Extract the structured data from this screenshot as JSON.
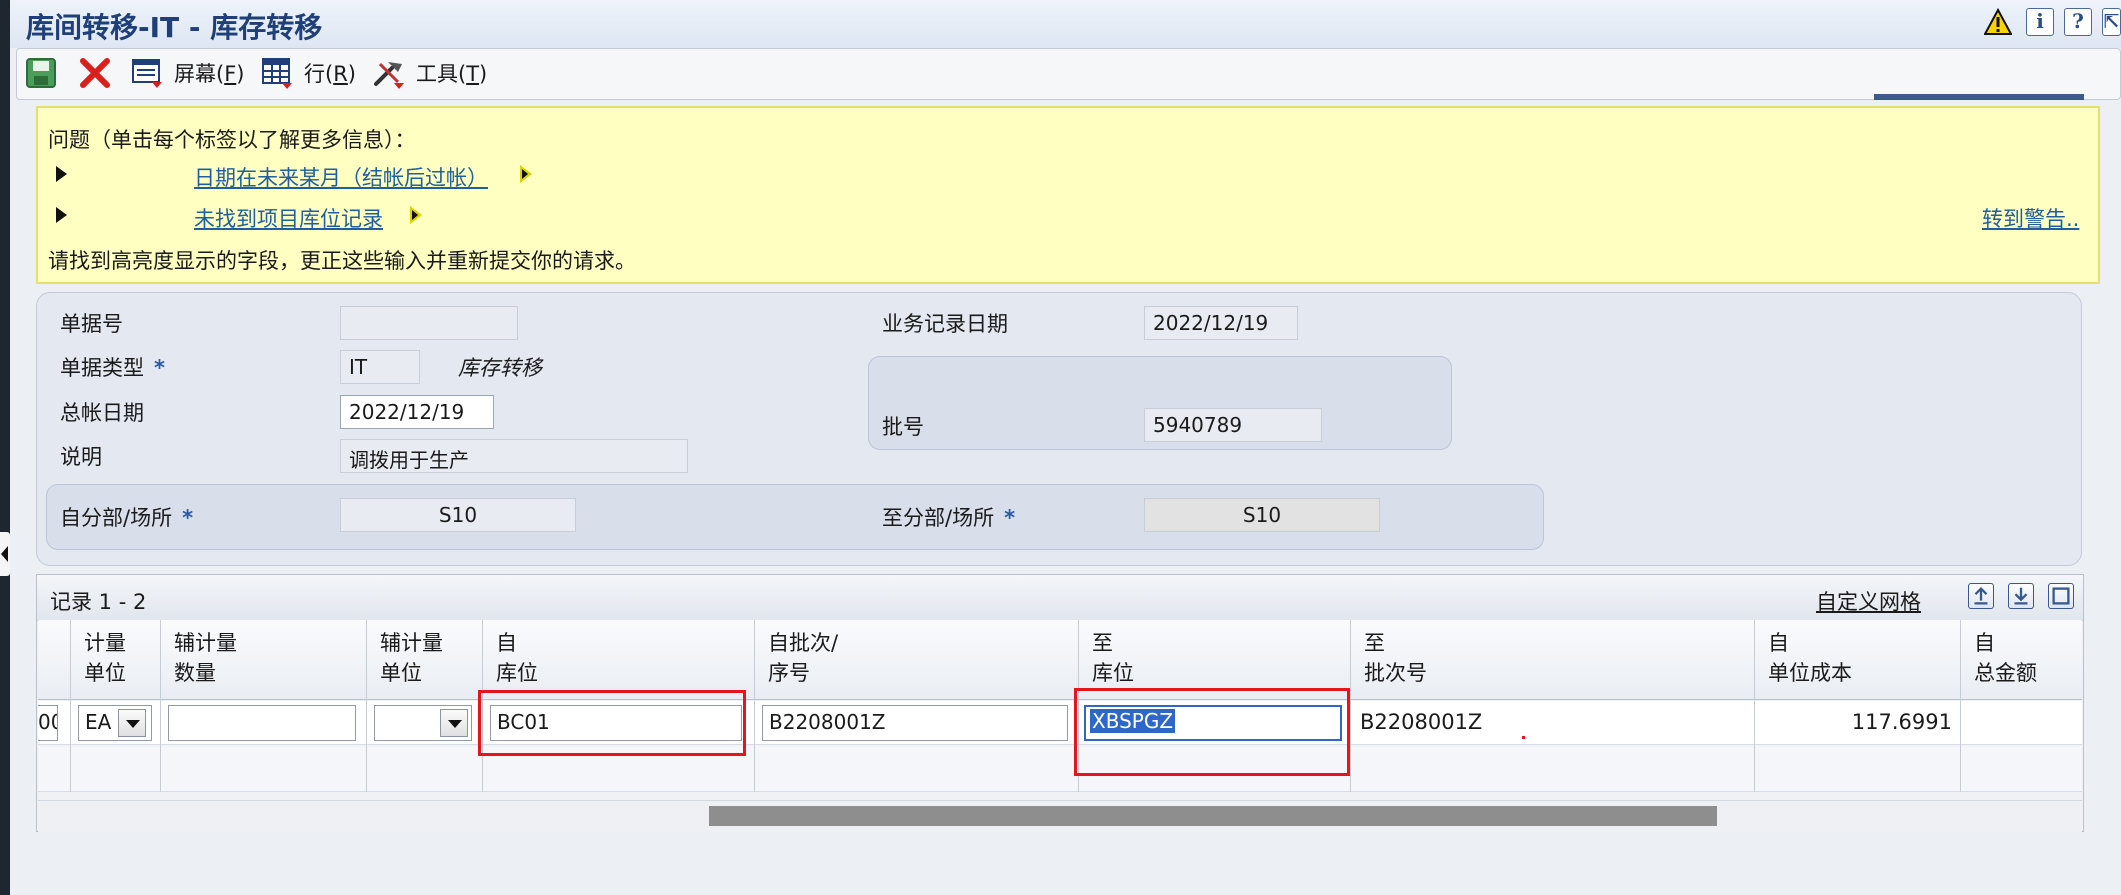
{
  "window": {
    "title": "库间转移-IT - 库存转移"
  },
  "toolbar": {
    "save_icon": "save-icon",
    "cancel_icon": "close-icon",
    "screen_label": "屏幕(",
    "screen_key": "F",
    "row_label": "行(",
    "row_key": "R",
    "tools_label": "工具(",
    "tools_key": "T",
    "close_paren": ")"
  },
  "messages": {
    "header": "问题（单击每个标签以了解更多信息）：",
    "items": [
      {
        "link": "日期在未来某月（结帐后过帐）"
      },
      {
        "link": "未找到项目库位记录"
      }
    ],
    "footer": "请找到高亮度显示的字段，更正这些输入并重新提交你的请求。",
    "goto_warning": "转到警告.."
  },
  "form": {
    "doc_no_label": "单据号",
    "doc_no_value": "",
    "doc_type_label": "单据类型",
    "doc_type_value": "IT",
    "doc_type_desc": "库存转移",
    "gl_date_label": "总帐日期",
    "gl_date_value": "2022/12/19",
    "desc_label": "说明",
    "desc_value": "调拨用于生产",
    "trans_date_label": "业务记录日期",
    "trans_date_value": "2022/12/19",
    "batch_label": "批号",
    "batch_value": "5940789",
    "from_bu_label": "自分部/场所",
    "from_bu_value": "S10",
    "to_bu_label": "至分部/场所",
    "to_bu_value": "S10",
    "required_mark": "*"
  },
  "grid": {
    "records": "记录 1 - 2",
    "customize": "自定义网格",
    "columns": [
      {
        "l1": "计量",
        "l2": "单位"
      },
      {
        "l1": "辅计量",
        "l2": "数量"
      },
      {
        "l1": "辅计量",
        "l2": "单位"
      },
      {
        "l1": "自",
        "l2": "库位"
      },
      {
        "l1": "自批次/",
        "l2": "序号"
      },
      {
        "l1": "至",
        "l2": "库位"
      },
      {
        "l1": "至",
        "l2": "批次号"
      },
      {
        "l1": "自",
        "l2": "单位成本"
      },
      {
        "l1": "自",
        "l2": "总金额"
      }
    ],
    "row1": {
      "qty_fragment": "00",
      "uom": "EA",
      "sec_qty": "",
      "sec_uom": "",
      "from_location": "BC01",
      "from_lot": "B2208001Z",
      "to_location": "XBSPGZ",
      "to_lot": "B2208001Z",
      "unit_cost": "117.6991",
      "total": ""
    }
  },
  "colors": {
    "title": "#1e3f78",
    "message_bg": "#ffffc2",
    "link": "#1f5fa0",
    "highlight_box": "#e4161b",
    "selection": "#2f67c8"
  }
}
